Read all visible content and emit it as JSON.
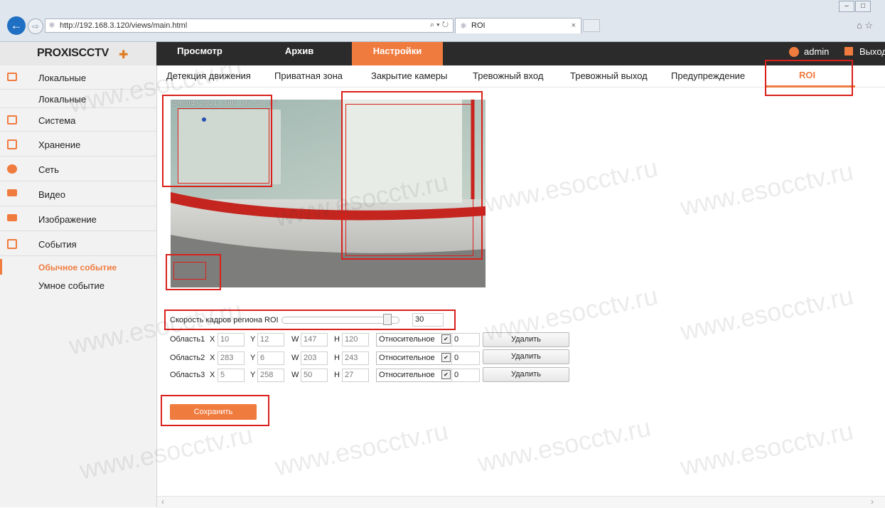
{
  "browser": {
    "address": "http://192.168.3.120/views/main.html",
    "address_tools": "⌕ ▾ ↻",
    "tab_title": "ROI",
    "tab_close": "×",
    "back": "←",
    "forward": "⇨",
    "home_star": "⌂ ☆",
    "win_min": "–",
    "win_max": "□"
  },
  "header": {
    "logo": "PROXISCCTV",
    "logo_mark": "✚",
    "nav": [
      "Просмотр",
      "Архив",
      "Настройки"
    ],
    "user": "admin",
    "logout": "Выход"
  },
  "sidebar": {
    "items": [
      {
        "label": "Локальные",
        "icon": "monitor-icon",
        "color": "#f07b3e"
      },
      {
        "label": "Система",
        "icon": "system-icon",
        "color": "#f07b3e"
      },
      {
        "label": "Хранение",
        "icon": "storage-icon",
        "color": "#f07b3e"
      },
      {
        "label": "Сеть",
        "icon": "network-icon",
        "color": "#f07b3e"
      },
      {
        "label": "Видео",
        "icon": "video-icon",
        "color": "#f07b3e"
      },
      {
        "label": "Изображение",
        "icon": "image-icon",
        "color": "#f07b3e"
      },
      {
        "label": "События",
        "icon": "events-icon",
        "color": "#f07b3e"
      }
    ],
    "sub_local": "Локальные",
    "sub_events_active": "Обычное событие",
    "sub_events_smart": "Умное событие"
  },
  "subtabs": [
    "Детекция движения",
    "Приватная зона",
    "Закрытие камеры",
    "Тревожный вход",
    "Тревожный выход",
    "Предупреждение",
    "ROI"
  ],
  "video": {
    "osd": "29/04/2021 THU 16:51:06"
  },
  "roi": {
    "rate_label": "Скорость кадров региона ROI",
    "rate_value": "30",
    "rate_level": 0.93,
    "regions": [
      {
        "label": "Область1",
        "x": "10",
        "y": "12",
        "w": "147",
        "h": "120",
        "mode": "Относительное",
        "val": "0",
        "delete": "Удалить"
      },
      {
        "label": "Область2",
        "x": "283",
        "y": "6",
        "w": "203",
        "h": "243",
        "mode": "Относительное",
        "val": "0",
        "delete": "Удалить"
      },
      {
        "label": "Область3",
        "x": "5",
        "y": "258",
        "w": "50",
        "h": "27",
        "mode": "Относительное",
        "val": "0",
        "delete": "Удалить"
      }
    ],
    "axis": {
      "x": "X",
      "y": "Y",
      "w": "W",
      "h": "H"
    },
    "save": "Сохранить"
  },
  "watermark": "www.esocctv.ru",
  "colors": {
    "accent": "#f07b3e",
    "header": "#2b2b2b",
    "annotation": "#d9201c"
  }
}
